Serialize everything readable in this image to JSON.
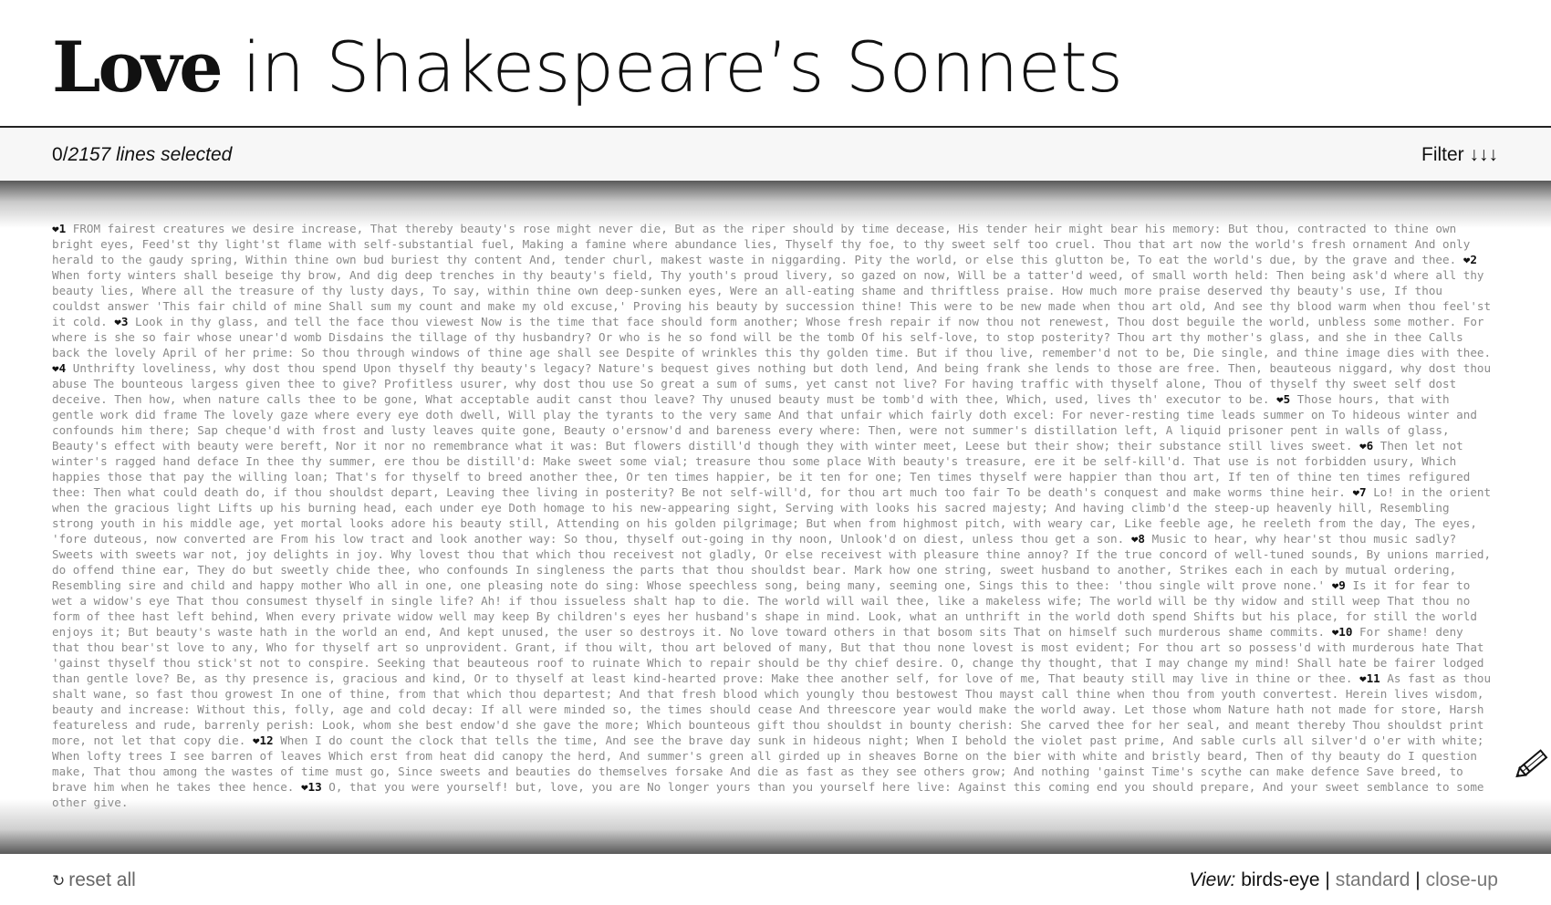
{
  "header": {
    "title_keyword": "Love",
    "title_rest": " in Shakespeare’s Sonnets"
  },
  "status": {
    "selected": "0",
    "total": "2157 lines selected",
    "filter_label": "Filter ↓↓↓"
  },
  "text": [
    {
      "marker": "❤1",
      "body": " FROM fairest creatures we desire increase, That thereby beauty's rose might never die, But as the riper should by time decease, His tender heir might bear his memory: But thou, contracted to thine own bright eyes, Feed'st thy light'st flame with self-substantial fuel, Making a famine where abundance lies, Thyself thy foe, to thy sweet self too cruel. Thou that art now the world's fresh ornament And only herald to the gaudy spring, Within thine own bud buriest thy content And, tender churl, makest waste in niggarding. Pity the world, or else this glutton be, To eat the world's due, by the grave and thee. "
    },
    {
      "marker": "❤2",
      "body": " When forty winters shall beseige thy brow, And dig deep trenches in thy beauty's field, Thy youth's proud livery, so gazed on now, Will be a tatter'd weed, of small worth held: Then being ask'd where all thy beauty lies, Where all the treasure of thy lusty days, To say, within thine own deep-sunken eyes, Were an all-eating shame and thriftless praise. How much more praise deserved thy beauty's use, If thou couldst answer 'This fair child of mine Shall sum my count and make my old excuse,' Proving his beauty by succession thine! This were to be new made when thou art old, And see thy blood warm when thou feel'st it cold. "
    },
    {
      "marker": "❤3",
      "body": " Look in thy glass, and tell the face thou viewest Now is the time that face should form another; Whose fresh repair if now thou not renewest, Thou dost beguile the world, unbless some mother. For where is she so fair whose unear'd womb Disdains the tillage of thy husbandry? Or who is he so fond will be the tomb Of his self-love, to stop posterity? Thou art thy mother's glass, and she in thee Calls back the lovely April of her prime: So thou through windows of thine age shall see Despite of wrinkles this thy golden time. But if thou live, remember'd not to be, Die single, and thine image dies with thee. "
    },
    {
      "marker": "❤4",
      "body": " Unthrifty loveliness, why dost thou spend Upon thyself thy beauty's legacy? Nature's bequest gives nothing but doth lend, And being frank she lends to those are free. Then, beauteous niggard, why dost thou abuse The bounteous largess given thee to give? Profitless usurer, why dost thou use So great a sum of sums, yet canst not live? For having traffic with thyself alone, Thou of thyself thy sweet self dost deceive. Then how, when nature calls thee to be gone, What acceptable audit canst thou leave? Thy unused beauty must be tomb'd with thee, Which, used, lives th' executor to be. "
    },
    {
      "marker": "❤5",
      "body": " Those hours, that with gentle work did frame The lovely gaze where every eye doth dwell, Will play the tyrants to the very same And that unfair which fairly doth excel: For never-resting time leads summer on To hideous winter and confounds him there; Sap cheque'd with frost and lusty leaves quite gone, Beauty o'ersnow'd and bareness every where: Then, were not summer's distillation left, A liquid prisoner pent in walls of glass, Beauty's effect with beauty were bereft, Nor it nor no remembrance what it was: But flowers distill'd though they with winter meet, Leese but their show; their substance still lives sweet. "
    },
    {
      "marker": "❤6",
      "body": " Then let not winter's ragged hand deface In thee thy summer, ere thou be distill'd: Make sweet some vial; treasure thou some place With beauty's treasure, ere it be self-kill'd. That use is not forbidden usury, Which happies those that pay the willing loan; That's for thyself to breed another thee, Or ten times happier, be it ten for one; Ten times thyself were happier than thou art, If ten of thine ten times refigured thee: Then what could death do, if thou shouldst depart, Leaving thee living in posterity? Be not self-will'd, for thou art much too fair To be death's conquest and make worms thine heir. "
    },
    {
      "marker": "❤7",
      "body": " Lo! in the orient when the gracious light Lifts up his burning head, each under eye Doth homage to his new-appearing sight, Serving with looks his sacred majesty; And having climb'd the steep-up heavenly hill, Resembling strong youth in his middle age, yet mortal looks adore his beauty still, Attending on his golden pilgrimage; But when from highmost pitch, with weary car, Like feeble age, he reeleth from the day, The eyes, 'fore duteous, now converted are From his low tract and look another way: So thou, thyself out-going in thy noon, Unlook'd on diest, unless thou get a son. "
    },
    {
      "marker": "❤8",
      "body": " Music to hear, why hear'st thou music sadly? Sweets with sweets war not, joy delights in joy. Why lovest thou that which thou receivest not gladly, Or else receivest with pleasure thine annoy? If the true concord of well-tuned sounds, By unions married, do offend thine ear, They do but sweetly chide thee, who confounds In singleness the parts that thou shouldst bear. Mark how one string, sweet husband to another, Strikes each in each by mutual ordering, Resembling sire and child and happy mother Who all in one, one pleasing note do sing: Whose speechless song, being many, seeming one, Sings this to thee: 'thou single wilt prove none.' "
    },
    {
      "marker": "❤9",
      "body": " Is it for fear to wet a widow's eye That thou consumest thyself in single life? Ah! if thou issueless shalt hap to die. The world will wail thee, like a makeless wife; The world will be thy widow and still weep That thou no form of thee hast left behind, When every private widow well may keep By children's eyes her husband's shape in mind. Look, what an unthrift in the world doth spend Shifts but his place, for still the world enjoys it; But beauty's waste hath in the world an end, And kept unused, the user so destroys it. No love toward others in that bosom sits That on himself such murderous shame commits. "
    },
    {
      "marker": "❤10",
      "body": " For shame! deny that thou bear'st love to any, Who for thyself art so unprovident. Grant, if thou wilt, thou art beloved of many, But that thou none lovest is most evident; For thou art so possess'd with murderous hate That 'gainst thyself thou stick'st not to conspire. Seeking that beauteous roof to ruinate Which to repair should be thy chief desire. O, change thy thought, that I may change my mind! Shall hate be fairer lodged than gentle love? Be, as thy presence is, gracious and kind, Or to thyself at least kind-hearted prove: Make thee another self, for love of me, That beauty still may live in thine or thee. "
    },
    {
      "marker": "❤11",
      "body": " As fast as thou shalt wane, so fast thou growest In one of thine, from that which thou departest; And that fresh blood which youngly thou bestowest Thou mayst call thine when thou from youth convertest. Herein lives wisdom, beauty and increase: Without this, folly, age and cold decay: If all were minded so, the times should cease And threescore year would make the world away. Let those whom Nature hath not made for store, Harsh featureless and rude, barrenly perish: Look, whom she best endow'd she gave the more; Which bounteous gift thou shouldst in bounty cherish: She carved thee for her seal, and meant thereby Thou shouldst print more, not let that copy die. "
    },
    {
      "marker": "❤12",
      "body": " When I do count the clock that tells the time, And see the brave day sunk in hideous night; When I behold the violet past prime, And sable curls all silver'd o'er with white; When lofty trees I see barren of leaves Which erst from heat did canopy the herd, And summer's green all girded up in sheaves Borne on the bier with white and bristly beard, Then of thy beauty do I question make, That thou among the wastes of time must go, Since sweets and beauties do themselves forsake And die as fast as they see others grow; And nothing 'gainst Time's scythe can make defence Save breed, to brave him when he takes thee hence. "
    },
    {
      "marker": "❤13",
      "body": " O, that you were yourself! but, love, you are No longer yours than you yourself here live: Against this coming end you should prepare, And your sweet semblance to some other give. "
    }
  ],
  "footer": {
    "reset_label": "reset all",
    "view_label": "View:",
    "views": [
      "birds-eye",
      "standard",
      "close-up"
    ],
    "sep": "|"
  },
  "icons": {
    "reset": "↻",
    "pencil": "pencil-icon"
  }
}
